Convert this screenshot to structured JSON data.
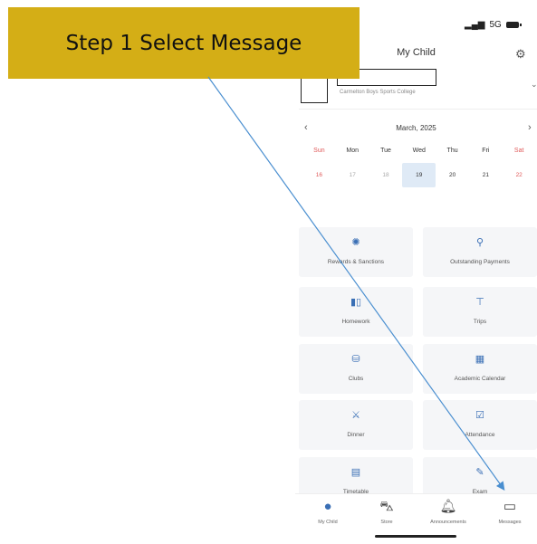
{
  "banner": {
    "text": "Step 1 Select Message",
    "color": "#d4ae16"
  },
  "status_bar": {
    "network": "5G"
  },
  "header": {
    "title": "My Child",
    "settings_icon": "gear-icon"
  },
  "child": {
    "school": "Carmelton Boys Sports College",
    "expand_icon": "chevron-down-icon"
  },
  "calendar": {
    "month": "March, 2025",
    "prev_icon": "chevron-left-icon",
    "next_icon": "chevron-right-icon",
    "days": [
      "Sun",
      "Mon",
      "Tue",
      "Wed",
      "Thu",
      "Fri",
      "Sat"
    ],
    "dates": [
      "16",
      "17",
      "18",
      "19",
      "20",
      "21",
      "22"
    ],
    "selected_date": "19",
    "weekend_color": "#e05a5a",
    "selected_bg": "#dfeaf6"
  },
  "tiles": [
    {
      "label": "Rewards & Sanctions",
      "icon": "reward-icon"
    },
    {
      "label": "Outstanding Payments",
      "icon": "payment-icon"
    },
    {
      "label": "Homework",
      "icon": "book-icon"
    },
    {
      "label": "Trips",
      "icon": "signpost-icon"
    },
    {
      "label": "Clubs",
      "icon": "club-icon"
    },
    {
      "label": "Academic Calendar",
      "icon": "calendar-icon"
    },
    {
      "label": "Dinner",
      "icon": "dinner-icon"
    },
    {
      "label": "Attendance",
      "icon": "attendance-icon"
    },
    {
      "label": "Timetable",
      "icon": "timetable-icon"
    },
    {
      "label": "Exam",
      "icon": "exam-icon"
    }
  ],
  "bottom_nav": [
    {
      "label": "My Child",
      "icon": "person-icon",
      "active": true
    },
    {
      "label": "Store",
      "icon": "shopping-bag-icon",
      "active": false
    },
    {
      "label": "Announcements",
      "icon": "bell-icon",
      "active": false
    },
    {
      "label": "Messages",
      "icon": "message-icon",
      "active": false
    }
  ],
  "accent_color": "#3a6fb5"
}
